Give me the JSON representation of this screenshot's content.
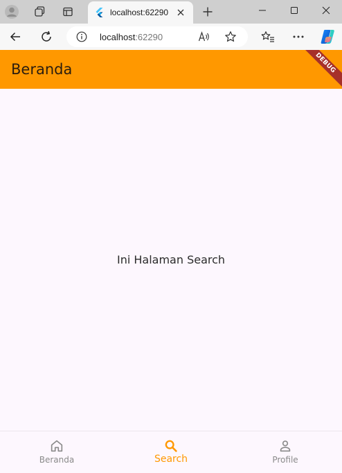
{
  "browser": {
    "tab_title": "localhost:62290",
    "url_host": "localhost",
    "url_port": ":62290"
  },
  "app": {
    "appbar_title": "Beranda",
    "debug_banner": "DEBUG",
    "body_text": "Ini Halaman Search",
    "bottom_nav": [
      {
        "label": "Beranda",
        "icon": "home-icon",
        "active": false
      },
      {
        "label": "Search",
        "icon": "search-icon",
        "active": true
      },
      {
        "label": "Profile",
        "icon": "person-icon",
        "active": false
      }
    ],
    "colors": {
      "primary": "#ff9800",
      "background": "#fdf7fe",
      "inactive": "#8a8a8a",
      "debug": "#a6302a"
    }
  }
}
